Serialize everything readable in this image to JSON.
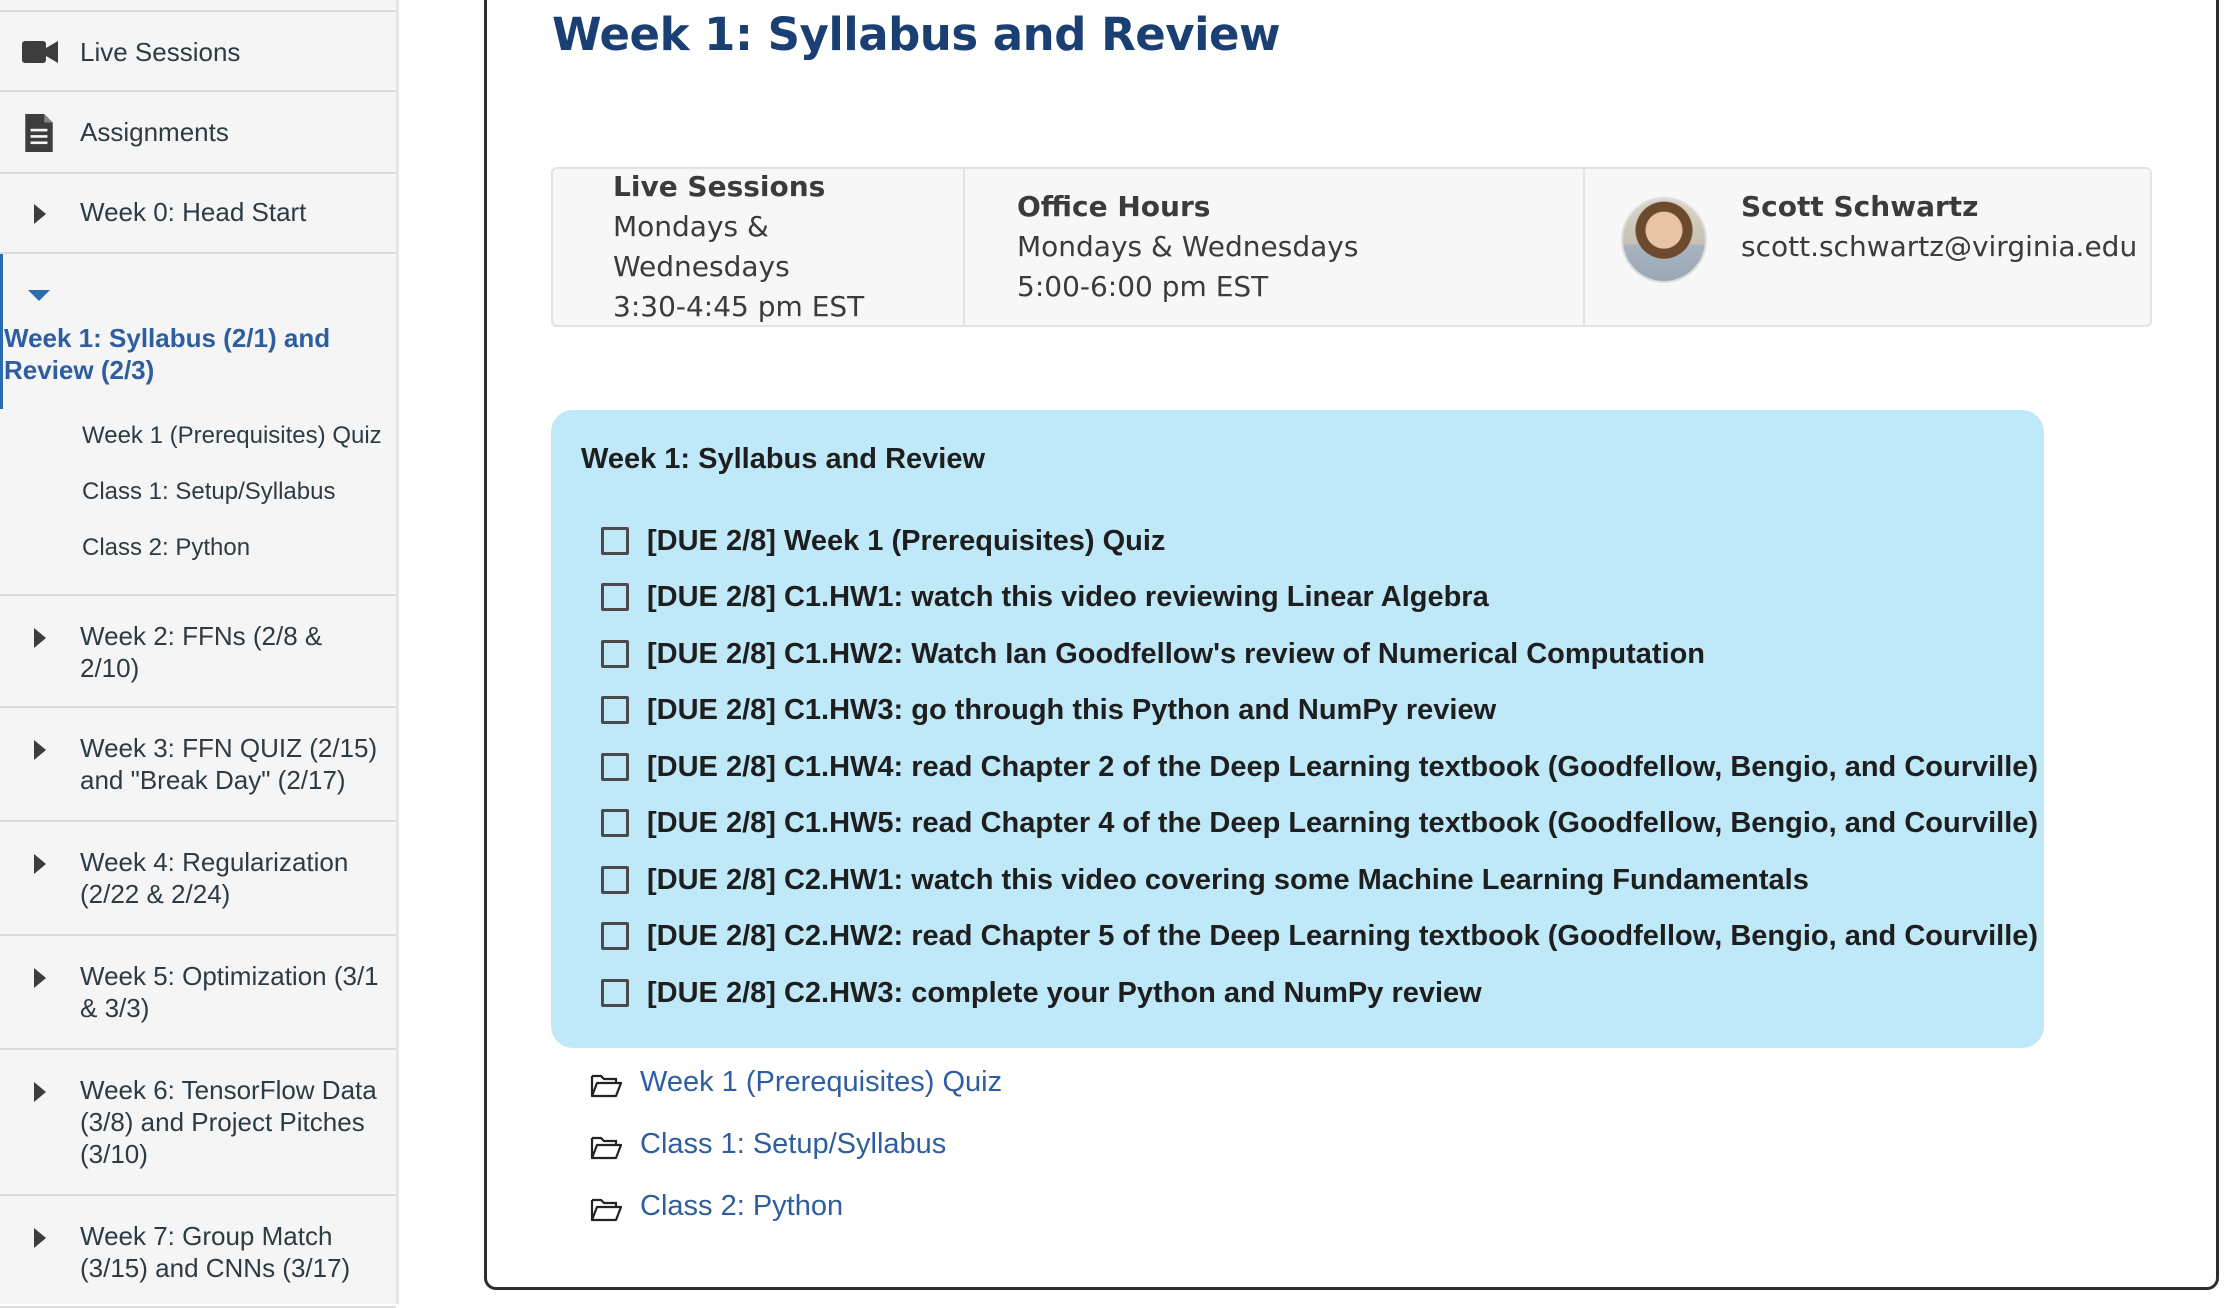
{
  "sidebar": {
    "live_sessions": {
      "label": "Live Sessions",
      "icon": "video-camera-icon"
    },
    "assignments": {
      "label": "Assignments",
      "icon": "document-icon"
    },
    "weeks": [
      {
        "label": "Week 0: Head Start"
      },
      {
        "label": "Week 1: Syllabus (2/1) and Review (2/3)",
        "expanded": true,
        "children": [
          "Week 1 (Prerequisites) Quiz",
          "Class 1: Setup/Syllabus",
          "Class 2: Python"
        ]
      },
      {
        "label": "Week 2: FFNs (2/8 & 2/10)"
      },
      {
        "label": "Week 3: FFN QUIZ (2/15) and \"Break Day\" (2/17)"
      },
      {
        "label": "Week 4: Regularization (2/22 & 2/24)"
      },
      {
        "label": "Week 5: Optimization (3/1 & 3/3)"
      },
      {
        "label": "Week 6: TensorFlow Data (3/8) and Project Pitches (3/10)"
      },
      {
        "label": "Week 7: Group Match (3/15) and CNNs (3/17)"
      }
    ]
  },
  "main": {
    "title": "Week 1: Syllabus and Review",
    "info": {
      "live_sessions": {
        "heading": "Live Sessions",
        "line1": "Mondays &",
        "line2": "Wednesdays",
        "line3": "3:30-4:45 pm EST"
      },
      "office_hours": {
        "heading": "Office Hours",
        "line1": "Mondays & Wednesdays",
        "line2": "5:00-6:00 pm EST"
      },
      "instructor": {
        "name": "Scott Schwartz",
        "email": "scott.schwartz@virginia.edu"
      }
    },
    "checklist": {
      "title": "Week 1: Syllabus and Review",
      "items": [
        "[DUE 2/8] Week 1 (Prerequisites) Quiz",
        "[DUE 2/8] C1.HW1: watch this video reviewing Linear Algebra",
        "[DUE 2/8] C1.HW2: Watch Ian Goodfellow's review of Numerical Computation",
        "[DUE 2/8] C1.HW3: go through this Python and NumPy review",
        "[DUE 2/8] C1.HW4: read Chapter 2 of the Deep Learning textbook (Goodfellow, Bengio, and Courville)",
        "[DUE 2/8] C1.HW5: read Chapter 4 of the Deep Learning textbook (Goodfellow, Bengio, and Courville)",
        "[DUE 2/8] C2.HW1: watch this video covering some Machine Learning Fundamentals",
        "[DUE 2/8] C2.HW2: read Chapter 5 of the Deep Learning textbook (Goodfellow, Bengio, and Courville)",
        "[DUE 2/8] C2.HW3: complete your Python and NumPy review"
      ]
    },
    "links": [
      "Week 1 (Prerequisites) Quiz",
      "Class 1: Setup/Syllabus",
      "Class 2: Python"
    ]
  },
  "colors": {
    "accent": "#2f5e9e",
    "title": "#1a3f72",
    "checklist_bg": "#bfe8f8",
    "sidebar_bg": "#f5f5f5"
  }
}
